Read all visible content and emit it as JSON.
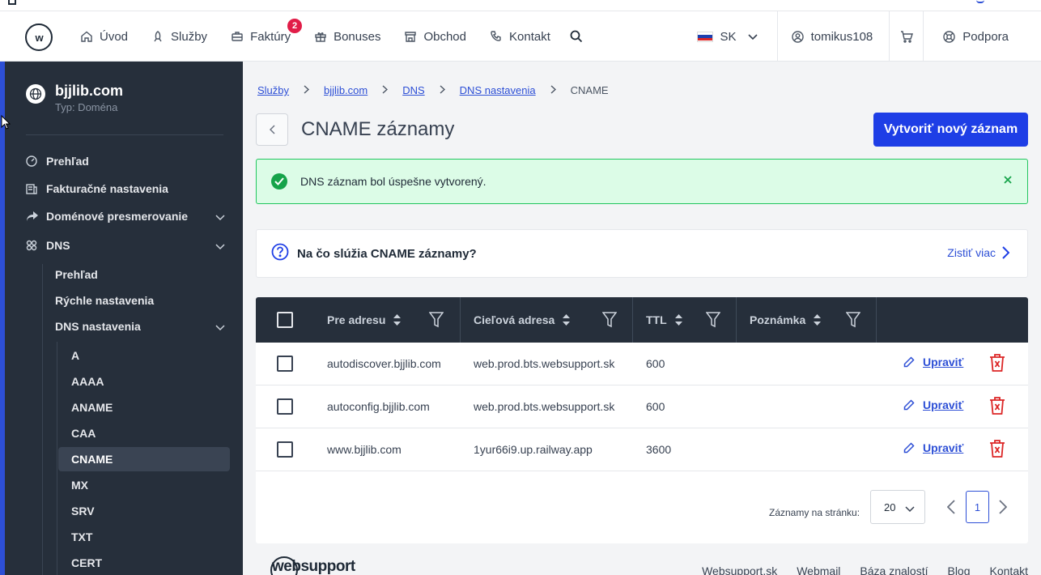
{
  "header": {
    "logo_text": "w",
    "nav": [
      {
        "label": "Úvod",
        "icon": "home-icon"
      },
      {
        "label": "Služby",
        "icon": "rocket-icon"
      },
      {
        "label": "Faktúry",
        "icon": "briefcase-icon",
        "badge": "2"
      },
      {
        "label": "Bonuses",
        "icon": "gift-icon"
      },
      {
        "label": "Obchod",
        "icon": "store-icon"
      },
      {
        "label": "Kontakt",
        "icon": "phone-icon"
      }
    ],
    "language": "SK",
    "username": "tomikus108",
    "support": "Podpora"
  },
  "sidebar": {
    "site_name": "bjjlib.com",
    "site_type": "Typ: Doména",
    "items": [
      {
        "label": "Prehľad"
      },
      {
        "label": "Fakturačné nastavenia"
      },
      {
        "label": "Doménové presmerovanie"
      },
      {
        "label": "DNS"
      }
    ],
    "dns_sub": [
      "Prehľad",
      "Rýchle nastavenia",
      "DNS nastavenia"
    ],
    "records": [
      "A",
      "AAAA",
      "ANAME",
      "CAA",
      "CNAME",
      "MX",
      "SRV",
      "TXT",
      "CERT"
    ],
    "active_record": "CNAME"
  },
  "breadcrumb": [
    "Služby",
    "bjjlib.com",
    "DNS",
    "DNS nastavenia",
    "CNAME"
  ],
  "page": {
    "title": "CNAME záznamy",
    "new_button": "Vytvoriť nový záznam"
  },
  "alert": {
    "text": "DNS záznam bol úspešne vytvorený."
  },
  "info": {
    "title": "Na čo slúžia CNAME záznamy?",
    "link": "Zistiť viac"
  },
  "table": {
    "columns": [
      "Pre adresu",
      "Cieľová adresa",
      "TTL",
      "Poznámka"
    ],
    "rows": [
      {
        "host": "autodiscover.bjjlib.com",
        "target": "web.prod.bts.websupport.sk",
        "ttl": "600",
        "note": ""
      },
      {
        "host": "autoconfig.bjjlib.com",
        "target": "web.prod.bts.websupport.sk",
        "ttl": "600",
        "note": ""
      },
      {
        "host": "www.bjjlib.com",
        "target": "1yur66i9.up.railway.app",
        "ttl": "3600",
        "note": ""
      }
    ],
    "edit_label": "Upraviť"
  },
  "pagination": {
    "per_page_label": "Záznamy na stránku:",
    "per_page": "20",
    "current_page": "1"
  },
  "footer": {
    "logo": "websupport",
    "links": [
      "Websupport.sk",
      "Webmail",
      "Báza znalostí",
      "Blog",
      "Kontakt"
    ]
  },
  "colors": {
    "primary": "#1e3ee6",
    "sidebar": "#262f3b",
    "success": "#16a34a",
    "danger": "#dc2626"
  }
}
